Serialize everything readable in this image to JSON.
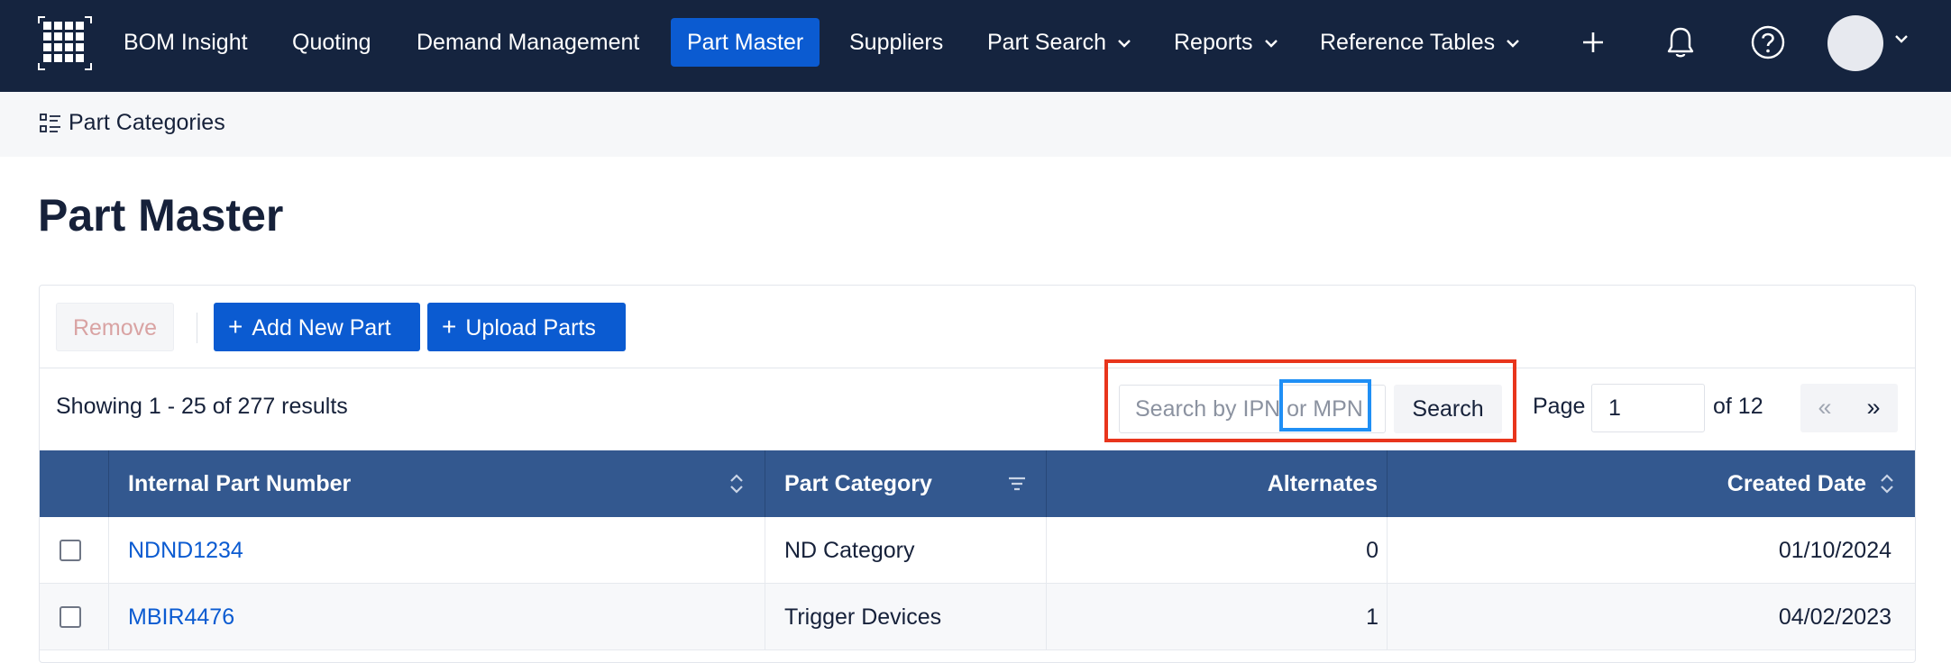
{
  "nav": {
    "items": [
      {
        "label": "BOM Insight"
      },
      {
        "label": "Quoting"
      },
      {
        "label": "Demand Management"
      },
      {
        "label": "Part Master"
      },
      {
        "label": "Suppliers"
      },
      {
        "label": "Part Search"
      },
      {
        "label": "Reports"
      },
      {
        "label": "Reference Tables"
      }
    ],
    "active": "Part Master",
    "icons": [
      "plus-icon",
      "bell-icon",
      "help-icon",
      "avatar"
    ]
  },
  "subbar": {
    "label": "Part Categories"
  },
  "page": {
    "title": "Part Master"
  },
  "toolbar": {
    "remove_label": "Remove",
    "add_label": "Add New Part",
    "upload_label": "Upload Parts"
  },
  "results": {
    "summary": "Showing 1 - 25 of 277 results"
  },
  "search": {
    "placeholder": "Search by IPN or MPN",
    "button_label": "Search"
  },
  "pagination": {
    "page_label": "Page",
    "current_page": "1",
    "of_label": "of 12",
    "prev": "«",
    "next": "»"
  },
  "table": {
    "columns": {
      "ipn": "Internal Part Number",
      "category": "Part Category",
      "alternates": "Alternates",
      "created": "Created Date"
    },
    "rows": [
      {
        "ipn": "NDND1234",
        "category": "ND Category",
        "alternates": "0",
        "created": "01/10/2024"
      },
      {
        "ipn": "MBIR4476",
        "category": "Trigger Devices",
        "alternates": "1",
        "created": "04/02/2023"
      }
    ]
  },
  "colors": {
    "nav_bg": "#15243f",
    "accent": "#0b5bd1",
    "table_header": "#33588f",
    "highlight_red": "#e8351c",
    "highlight_blue": "#1f8ff5"
  }
}
